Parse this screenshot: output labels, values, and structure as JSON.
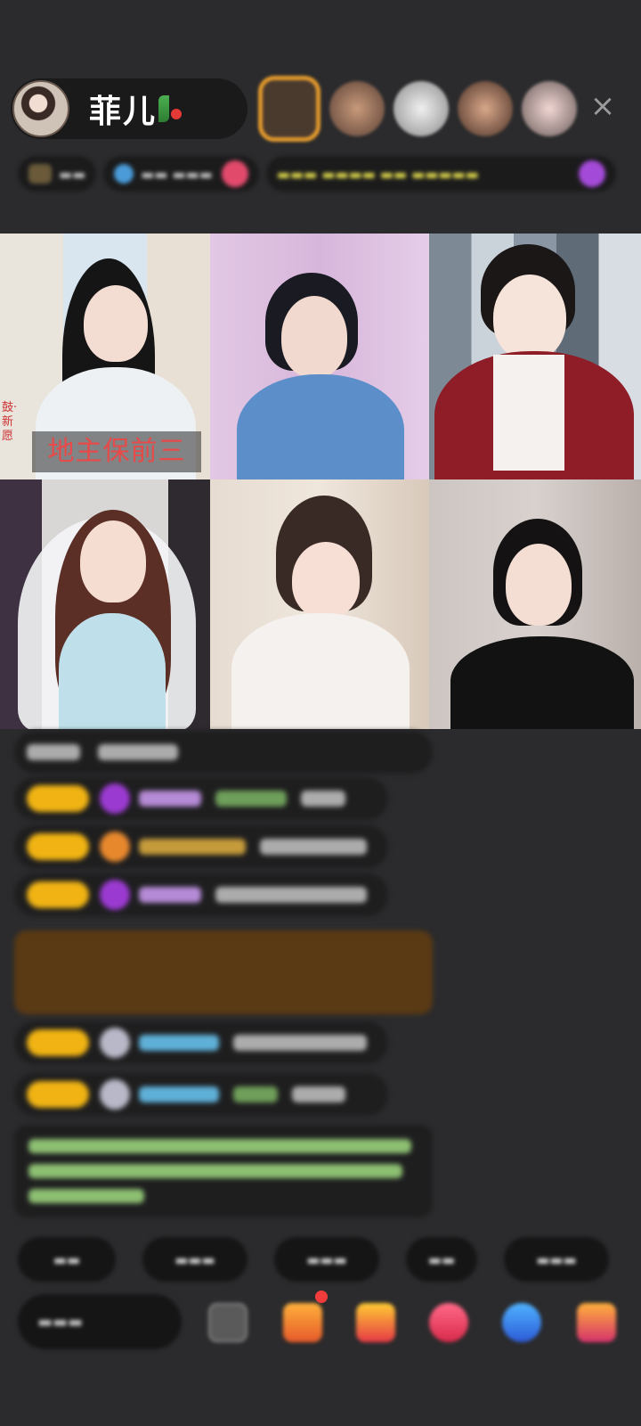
{
  "header": {
    "host_name": "菲儿"
  },
  "video_grid": {
    "overlay_caption": "地主保前三",
    "side_caption": "鼓·新愿"
  },
  "colors": {
    "background": "#2b2b2d",
    "badge_gold": "#f0b313",
    "gift_banner": "#5a3a14",
    "overlay_text_red": "#e84a4a"
  },
  "icons": {
    "close": "close-icon",
    "more": "more-icon",
    "gift_box": "gift-box-icon",
    "gift": "gift-icon",
    "game": "game-icon",
    "chat": "chat-icon"
  }
}
